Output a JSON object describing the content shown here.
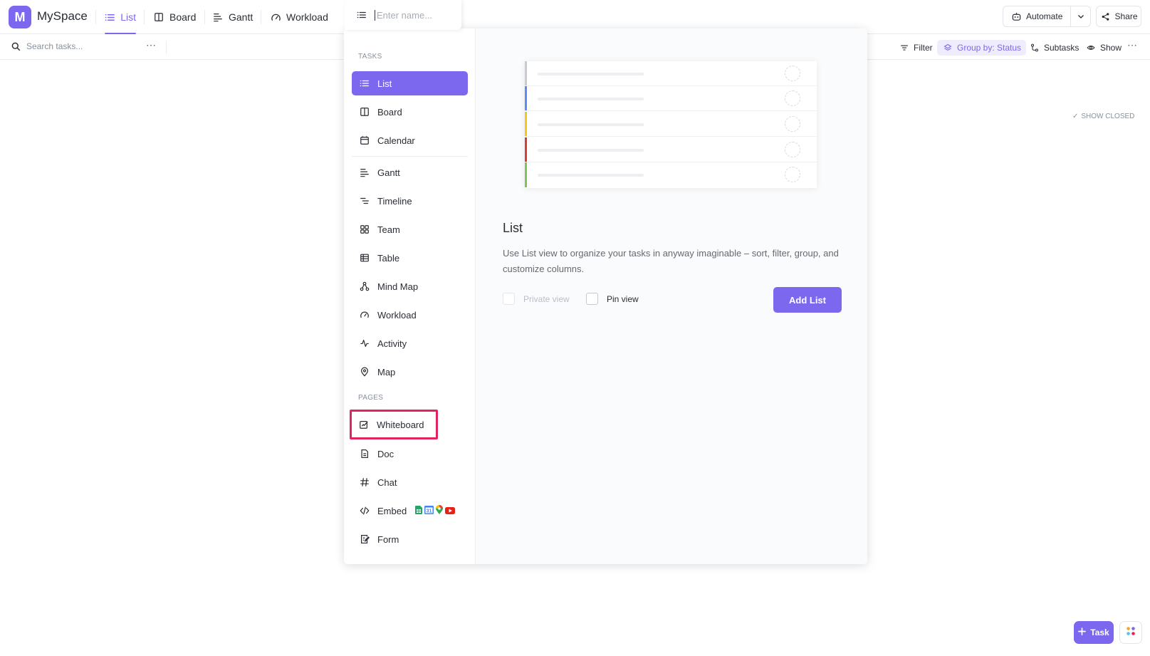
{
  "workspace": {
    "initial": "M",
    "name": "MySpace"
  },
  "tabs": [
    {
      "label": "List",
      "icon": "list-icon"
    },
    {
      "label": "Board",
      "icon": "board-icon"
    },
    {
      "label": "Gantt",
      "icon": "gantt-icon"
    },
    {
      "label": "Workload",
      "icon": "workload-icon"
    }
  ],
  "header": {
    "automate_label": "Automate",
    "share_label": "Share"
  },
  "toolbar": {
    "search_placeholder": "Search tasks...",
    "filter_label": "Filter",
    "group_by_label": "Group by: Status",
    "subtasks_label": "Subtasks",
    "show_label": "Show"
  },
  "show_closed_label": "SHOW CLOSED",
  "view_popup": {
    "name_placeholder": "Enter name...",
    "tasks_section": "TASKS",
    "pages_section": "PAGES",
    "task_views": [
      {
        "label": "List",
        "icon": "list-icon"
      },
      {
        "label": "Board",
        "icon": "board-icon"
      },
      {
        "label": "Calendar",
        "icon": "calendar-icon"
      },
      {
        "label": "Gantt",
        "icon": "gantt-icon"
      },
      {
        "label": "Timeline",
        "icon": "timeline-icon"
      },
      {
        "label": "Team",
        "icon": "team-icon"
      },
      {
        "label": "Table",
        "icon": "table-icon"
      },
      {
        "label": "Mind Map",
        "icon": "mind-map-icon"
      },
      {
        "label": "Workload",
        "icon": "workload-icon"
      },
      {
        "label": "Activity",
        "icon": "activity-icon"
      },
      {
        "label": "Map",
        "icon": "map-pin-icon"
      }
    ],
    "page_views": [
      {
        "label": "Whiteboard",
        "icon": "whiteboard-icon"
      },
      {
        "label": "Doc",
        "icon": "doc-icon"
      },
      {
        "label": "Chat",
        "icon": "hash-icon"
      },
      {
        "label": "Embed",
        "icon": "code-icon"
      },
      {
        "label": "Form",
        "icon": "form-icon"
      }
    ],
    "embed_badges": [
      {
        "icon": "google-sheets-icon",
        "color": "#23a566"
      },
      {
        "icon": "google-calendar-icon",
        "color": "#4285f4",
        "text": "31"
      },
      {
        "icon": "google-maps-icon",
        "color": "#ea4335"
      },
      {
        "icon": "youtube-icon",
        "color": "#e62117"
      }
    ],
    "preview": {
      "title": "List",
      "description": "Use List view to organize your tasks in anyway imaginable – sort, filter, group, and customize columns.",
      "private_view_label": "Private view",
      "pin_view_label": "Pin view",
      "add_button_label": "Add List",
      "row_colors": [
        "#c8ccd2",
        "#5b8def",
        "#f5c518",
        "#d93b3b",
        "#7fc35a"
      ]
    }
  },
  "fab": {
    "task_label": "Task"
  },
  "colors": {
    "accent": "#7b68ee",
    "highlight": "#e0245e"
  }
}
